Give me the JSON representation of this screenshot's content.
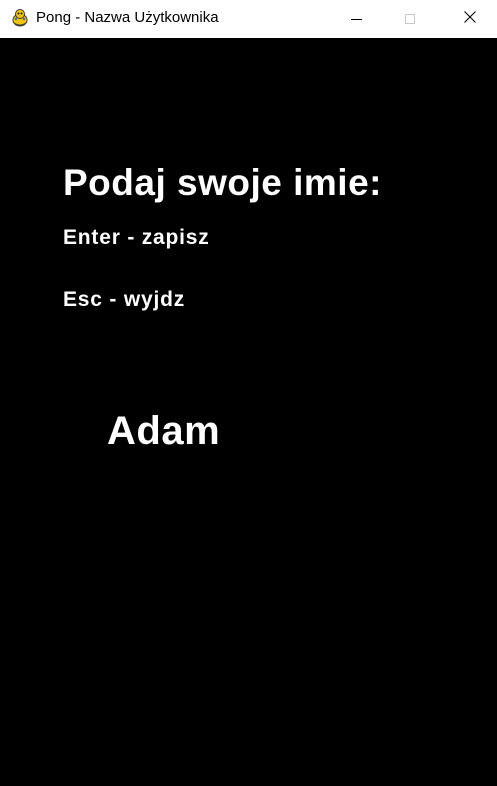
{
  "window": {
    "title": "Pong - Nazwa Użytkownika",
    "icon": "pygame-snake-icon",
    "controls": {
      "minimize_icon": "minimize-icon",
      "maximize_icon": "maximize-icon",
      "close_icon": "close-icon"
    }
  },
  "screen": {
    "background": "#000000",
    "text_color": "#ffffff",
    "prompt": "Podaj swoje imie:",
    "hint_enter": "Enter - zapisz",
    "hint_esc": "Esc - wyjdz",
    "username_value": "Adam"
  }
}
